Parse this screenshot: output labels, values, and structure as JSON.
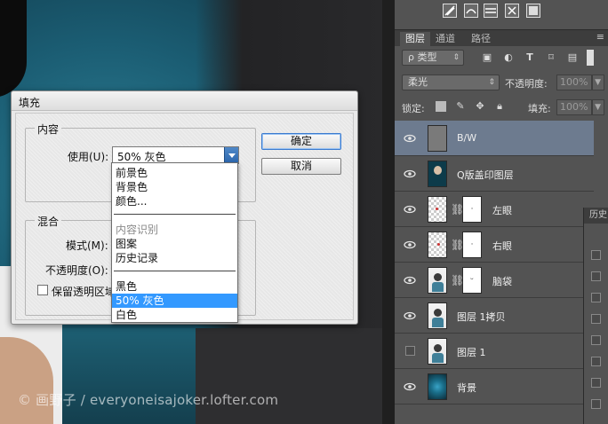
{
  "watermark": "© 画野子 / everyoneisajoker.lofter.com",
  "layers_panel": {
    "tabs": [
      "图层",
      "通道",
      "路径"
    ],
    "filter": {
      "label": "ρ 类型"
    },
    "blend_mode": "柔光",
    "opacity_label": "不透明度:",
    "opacity_value": "100%",
    "lock_label": "锁定:",
    "fill_label": "填充:",
    "fill_value": "100%",
    "layers": [
      {
        "name": "B/W",
        "visible": true,
        "selected": true
      },
      {
        "name": "Q版盖印图层",
        "visible": true
      },
      {
        "name": "左眼",
        "visible": true,
        "has_mask": true
      },
      {
        "name": "右眼",
        "visible": true,
        "has_mask": true
      },
      {
        "name": "脑袋",
        "visible": true,
        "has_mask": true
      },
      {
        "name": "图层 1拷贝",
        "visible": true
      },
      {
        "name": "图层 1",
        "visible": false
      },
      {
        "name": "背景",
        "visible": true
      }
    ]
  },
  "history_panel": {
    "title": "历史"
  },
  "fill_dialog": {
    "title": "填充",
    "content_group": "内容",
    "use_label": "使用(U):",
    "use_value": "50% 灰色",
    "ok_button": "确定",
    "cancel_button": "取消",
    "blend_group": "混合",
    "mode_label": "模式(M):",
    "opacity_label": "不透明度(O):",
    "preserve_label": "保留透明区域",
    "dropdown_options": [
      {
        "label": "前景色"
      },
      {
        "label": "背景色"
      },
      {
        "label": "颜色..."
      },
      {
        "label": "内容识别",
        "disabled": true
      },
      {
        "label": "图案"
      },
      {
        "label": "历史记录"
      },
      {
        "label": "黑色"
      },
      {
        "label": "50% 灰色",
        "selected": true
      },
      {
        "label": "白色"
      }
    ]
  },
  "colors": {
    "panel_bg": "#535353",
    "selected_layer": "#6d7b8f",
    "selection_blue": "#3399ff"
  }
}
